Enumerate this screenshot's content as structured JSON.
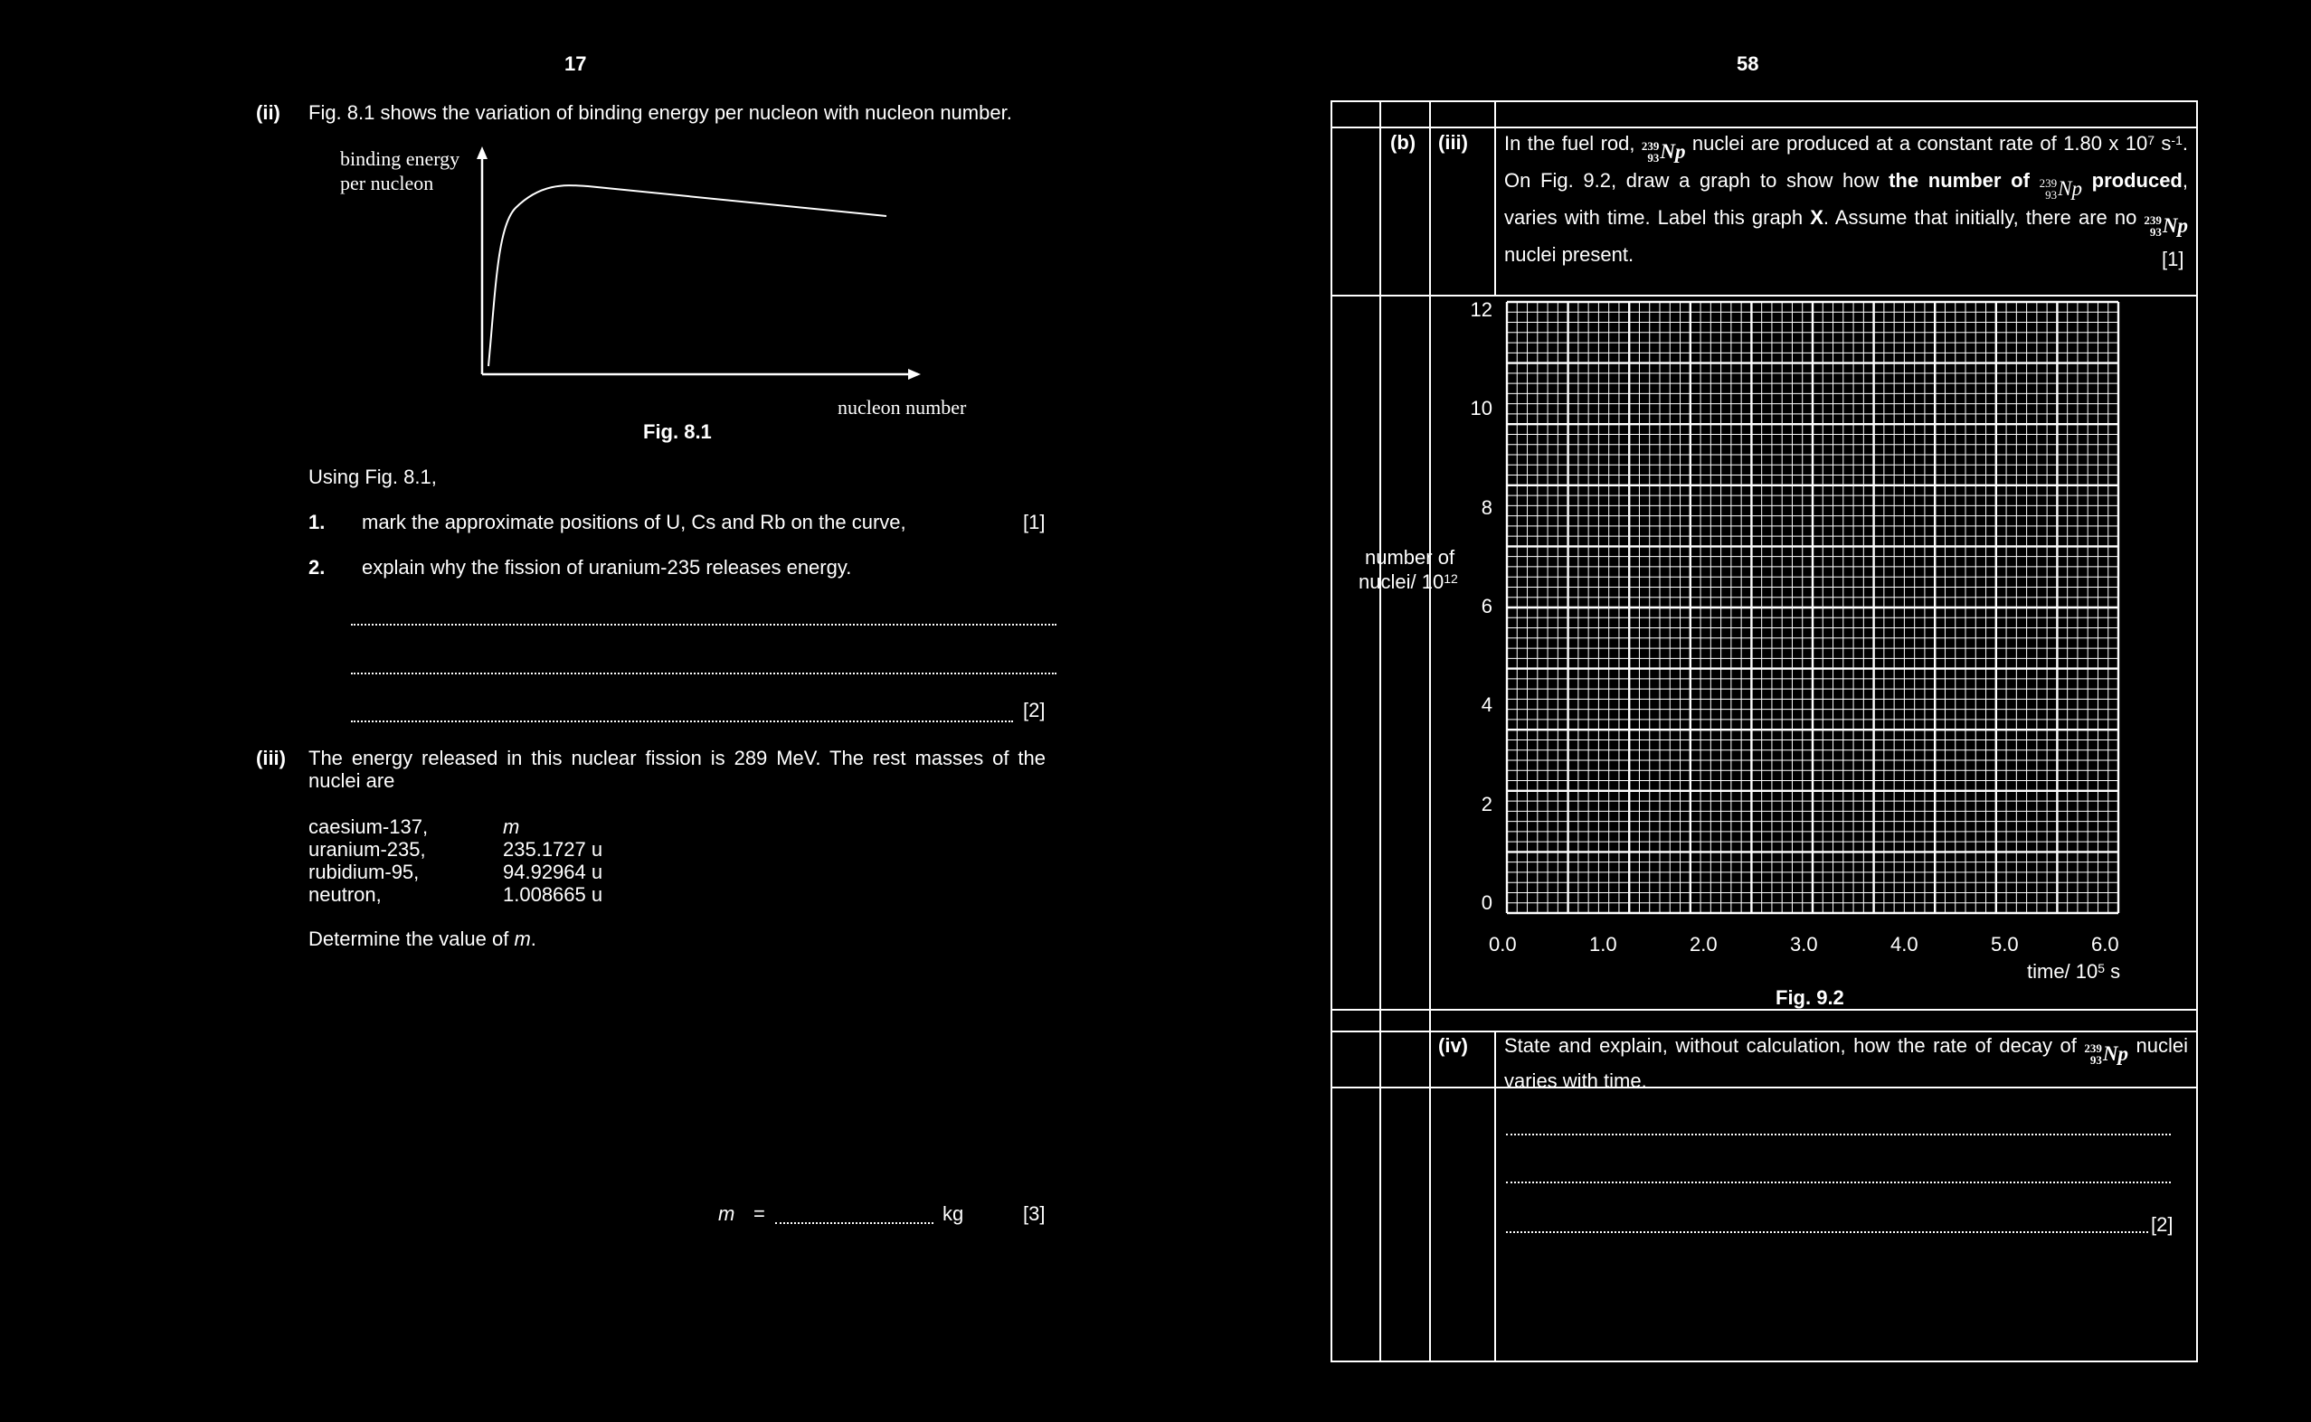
{
  "left": {
    "page_no": "17",
    "q_ii": {
      "label": "(ii)",
      "text": "Fig. 8.1 shows the variation of binding energy per nucleon with nucleon number.",
      "fig": {
        "y_label_1": "binding energy",
        "y_label_2": "per nucleon",
        "x_label": "nucleon number",
        "caption": "Fig. 8.1"
      },
      "using": "Using Fig. 8.1,",
      "items": [
        {
          "num": "1.",
          "text": "mark the approximate positions of U, Cs and Rb on the curve,",
          "mark": "[1]"
        },
        {
          "num": "2.",
          "text": "explain why the fission of uranium-235 releases energy.",
          "mark": "[2]"
        }
      ]
    },
    "q_iii": {
      "label": "(iii)",
      "text": "The energy released in this nuclear fission is 289 MeV. The rest masses of the nuclei are",
      "masses": [
        {
          "name": "caesium-137,",
          "value": "m"
        },
        {
          "name": "uranium-235,",
          "value": "235.1727 u"
        },
        {
          "name": "rubidium-95,",
          "value": "94.92964 u"
        },
        {
          "name": "neutron,",
          "value": "1.008665 u"
        }
      ],
      "determine_1": "Determine the value of ",
      "determine_var": "m",
      "determine_2": ".",
      "answer_var": "m",
      "answer_eq": "=",
      "answer_unit": "kg",
      "answer_mark": "[3]"
    }
  },
  "right": {
    "page_no": "58",
    "part_b": "(b)",
    "part_iii": "(iii)",
    "iii": {
      "t1": "In the fuel rod, ",
      "t2": " nuclei are produced at a constant rate of 1.80 x 10",
      "t2_exp": "7",
      "t3": " s",
      "t3_exp": "-1",
      "t4": ".  On Fig. 9.2, draw a graph to show how ",
      "t5_bold": "the number of",
      "t6_bold": "produced",
      "t7": ", varies with time.  Label this graph ",
      "t8_bold": "X",
      "t9": ".  Assume that initially, there are no ",
      "t10": " nuclei present.",
      "mark": "[1]"
    },
    "nuclide": {
      "mass": "239",
      "atomic": "93",
      "symbol": "Np"
    },
    "part_iv": "(iv)",
    "iv": {
      "t1": "State and explain, without calculation, how the rate of decay of ",
      "t2": " nuclei varies with time.",
      "mark": "[2]"
    }
  },
  "chart_data": {
    "type": "line",
    "title": "",
    "caption": "Fig. 9.2",
    "xlabel": "time/ 10",
    "xlabel_exp": "5",
    "xlabel_unit": " s",
    "ylabel_1": "number of",
    "ylabel_2": "nuclei/ 10",
    "ylabel_exp": "12",
    "xlim": [
      0,
      6
    ],
    "ylim": [
      0,
      12
    ],
    "x_ticks": [
      "0.0",
      "1.0",
      "2.0",
      "3.0",
      "4.0",
      "5.0",
      "6.0"
    ],
    "y_ticks": [
      "0",
      "2",
      "4",
      "6",
      "8",
      "10",
      "12"
    ],
    "grid": true,
    "series": []
  }
}
